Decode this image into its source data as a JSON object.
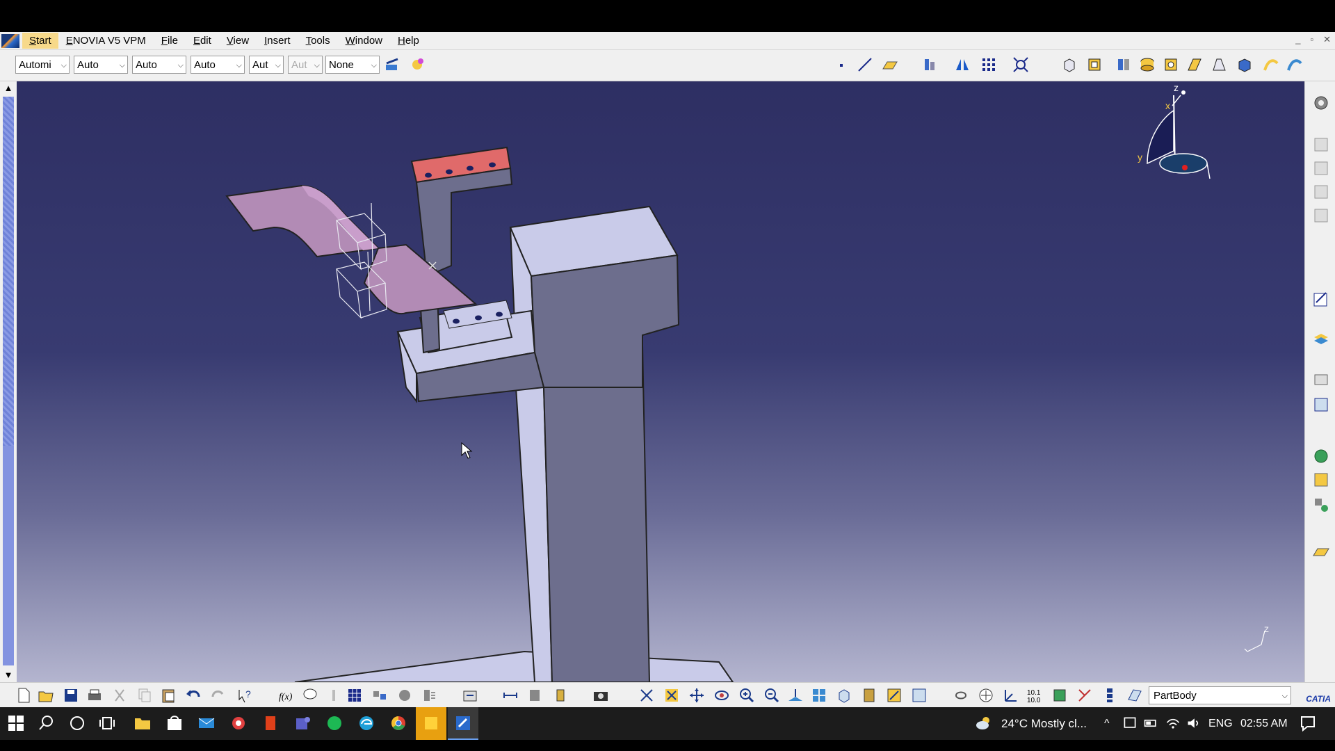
{
  "menu": {
    "start": "Start",
    "enovia": "ENOVIA V5 VPM",
    "items": [
      "File",
      "Edit",
      "View",
      "Insert",
      "Tools",
      "Window",
      "Help"
    ],
    "window_controls": [
      "_",
      "▫",
      "✕"
    ]
  },
  "toolbar": {
    "combos": [
      "Automi",
      "Auto",
      "Auto",
      "Auto",
      "Aut",
      "Aut",
      "None"
    ]
  },
  "viewport": {
    "compass_labels": {
      "z": "z",
      "x": "x",
      "y": "y"
    },
    "axis_label": "Z"
  },
  "bottom": {
    "body_select": "PartBody",
    "brand": "CATIA"
  },
  "taskbar": {
    "weather": "24°C  Mostly cl...",
    "language": "ENG",
    "time": "02:55 AM"
  },
  "colors": {
    "viewport_top": "#2e2f63",
    "part_face": "#6b6b8e",
    "part_top": "#c9cbe9",
    "sheet": "#b28bb5",
    "highlight_face": "#e06a6a"
  }
}
